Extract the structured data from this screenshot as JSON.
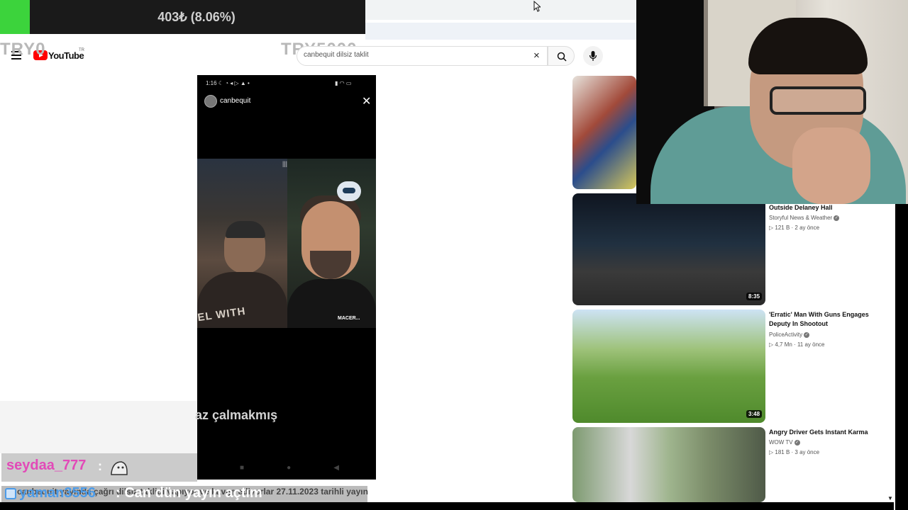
{
  "stream_overlay": {
    "progress_text": "403₺ (8.06%)",
    "progress_fraction": 0.0806,
    "goal_left": "TRY0",
    "goal_right": "TRY5000",
    "faded_caption": "az çalmakmış"
  },
  "youtube": {
    "logo_text": "YouTube",
    "region": "TR",
    "search_value": "canbequit dilsiz taklit",
    "clear_icon": "×",
    "icons": [
      "menu-icon",
      "youtube-logo-icon",
      "search-icon",
      "close-icon",
      "mic-icon"
    ]
  },
  "phone_video": {
    "status_time": "1:16",
    "status_icons_left": "☾ ◔ ◂ ▷ ▲ •",
    "status_icons_right": "▮ ◠ ▭",
    "username": "canbequit",
    "close": "✕",
    "shirt_text": "EL WITH",
    "call_name": "MACER...",
    "mic_indicator": "|||",
    "nav_buttons": [
      "■",
      "●",
      "◀"
    ]
  },
  "video_title": "canbequit yayında çağrı dilsiz taklidi yapıyor ve kavga ediyorlar 27.11.2023 tarihli yayın",
  "chat": [
    {
      "user": "seydaa_777",
      "separator": ":",
      "message": ""
    },
    {
      "user": "yaman3556",
      "separator": ":",
      "message": "Can dün yayın açtım"
    }
  ],
  "recommendations": [
    {
      "title": "",
      "channel": "",
      "meta": "",
      "duration": ""
    },
    {
      "title": "Outside Delaney Hall",
      "channel": "Storyful News & Weather",
      "meta": "▷ 121 B · 2 ay önce",
      "duration": "8:35"
    },
    {
      "title": "'Erratic' Man With Guns Engages Deputy In Shootout",
      "channel": "PoliceActivity",
      "meta": "▷ 4,7 Mn · 11 ay önce",
      "duration": "3:48"
    },
    {
      "title": "Angry Driver Gets Instant Karma",
      "channel": "WOW TV",
      "meta": "▷ 181 B · 3 ay önce",
      "duration": ""
    }
  ],
  "colors": {
    "progress_fill": "#3cd33c",
    "youtube_red": "#ff0000",
    "chat_user1": "#e24ab8",
    "chat_user2": "#4c9be8"
  }
}
